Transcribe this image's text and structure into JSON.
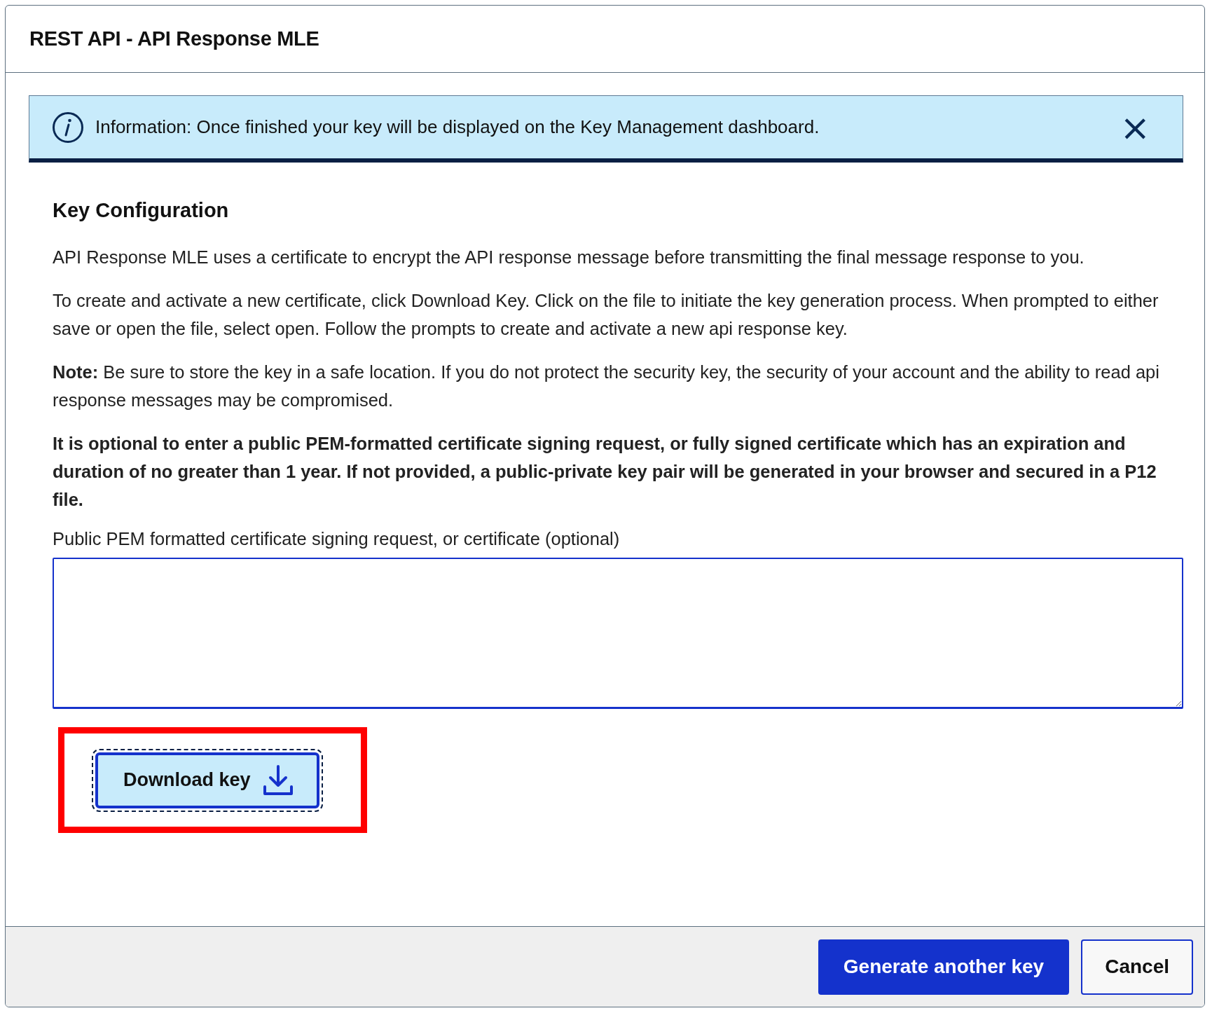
{
  "dialog": {
    "title": "REST API - API Response MLE"
  },
  "info_banner": {
    "text": "Information: Once finished your key will be displayed on the Key Management dashboard.",
    "close": "×"
  },
  "section": {
    "heading": "Key Configuration",
    "paragraphs": [
      {
        "kind": "plain",
        "text": "API Response MLE uses a certificate to encrypt the API response message before transmitting the final message response to you."
      },
      {
        "kind": "plain",
        "text": "To create and activate a new certificate, click Download Key. Click on the file to initiate the key generation process. When prompted to either save or open the file, select open. Follow the prompts to create and activate a new api response key."
      },
      {
        "kind": "plain",
        "text": "**Note:** Be sure to store the key in a safe location. If you do not protect the security key, the security of your account and the ability to read api response messages may be compromised."
      },
      {
        "kind": "bold",
        "text": "It is optional to enter a public PEM-formatted certificate signing request, or fully signed certificate which has an expiration and duration of no greater than 1 year. If not provided, a public-private key pair will be generated in your browser and secured in a P12 file."
      }
    ],
    "field": {
      "label": "Public PEM formatted certificate signing request, or certificate (optional)"
    },
    "download_button": {
      "label": "Download key",
      "focused": true,
      "highlighted": true
    }
  },
  "footer": {
    "buttons": [
      {
        "label": "Generate another key",
        "kind": "primary"
      },
      {
        "label": "Cancel",
        "kind": "secondary"
      }
    ]
  }
}
